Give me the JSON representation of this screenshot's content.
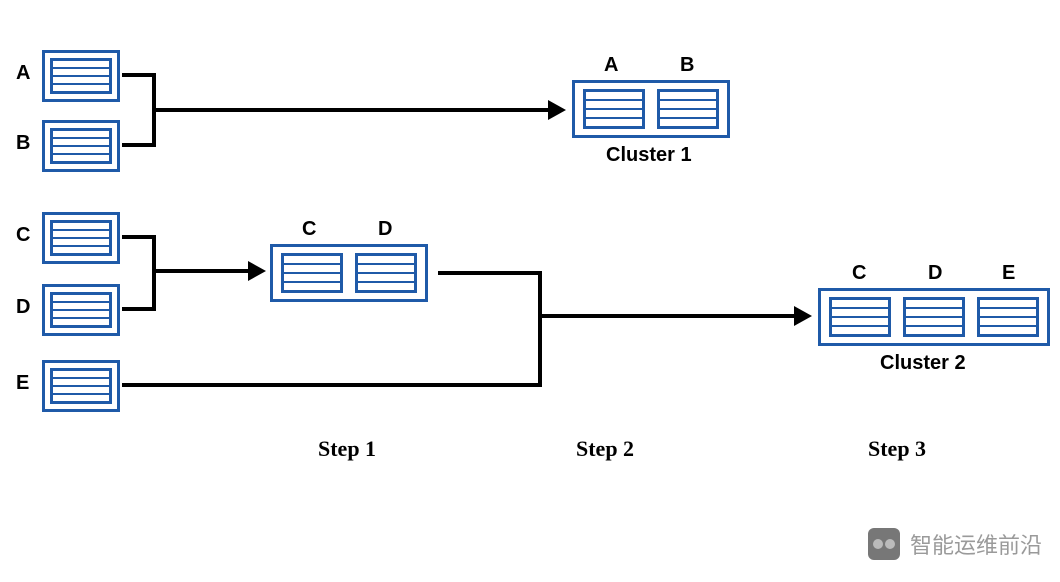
{
  "nodes": {
    "A": "A",
    "B": "B",
    "C": "C",
    "D": "D",
    "E": "E"
  },
  "mid": {
    "CD_labels": {
      "C": "C",
      "D": "D"
    }
  },
  "clusters": {
    "1": {
      "title": "Cluster 1",
      "labels": {
        "A": "A",
        "B": "B"
      }
    },
    "2": {
      "title": "Cluster 2",
      "labels": {
        "C": "C",
        "D": "D",
        "E": "E"
      }
    }
  },
  "steps": {
    "1": "Step 1",
    "2": "Step 2",
    "3": "Step 3"
  },
  "watermark": "智能运维前沿",
  "colors": {
    "stroke": "#1f5aa8"
  },
  "diagram_description": "Hierarchical clustering flow: A and B merge into Cluster 1; C and D merge (Step 1), then combine with E (Step 2) to form Cluster 2 (Step 3)."
}
